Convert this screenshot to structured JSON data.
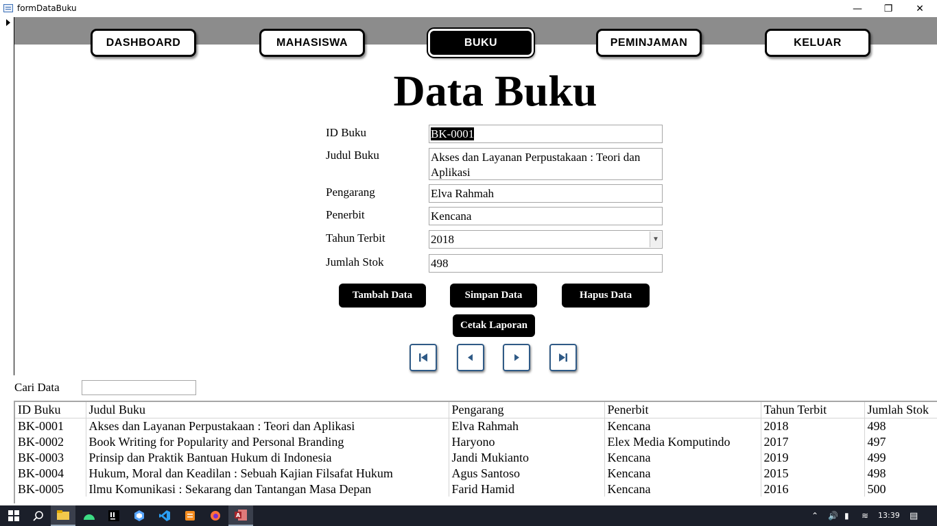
{
  "window": {
    "title": "formDataBuku",
    "minimize": "—",
    "restore": "❐",
    "close": "✕"
  },
  "nav": {
    "dashboard": "DASHBOARD",
    "mahasiswa": "MAHASISWA",
    "buku": "BUKU",
    "peminjaman": "PEMINJAMAN",
    "keluar": "KELUAR",
    "active": "BUKU"
  },
  "page": {
    "title": "Data Buku"
  },
  "form": {
    "id_buku": {
      "label": "ID Buku",
      "value": "BK-0001"
    },
    "judul_buku": {
      "label": "Judul Buku",
      "value": "Akses dan Layanan Perpustakaan : Teori dan Aplikasi"
    },
    "pengarang": {
      "label": "Pengarang",
      "value": "Elva Rahmah"
    },
    "penerbit": {
      "label": "Penerbit",
      "value": "Kencana"
    },
    "tahun_terbit": {
      "label": "Tahun Terbit",
      "value": "2018"
    },
    "jumlah_stok": {
      "label": "Jumlah Stok",
      "value": "498"
    }
  },
  "actions": {
    "tambah": "Tambah Data",
    "simpan": "Simpan Data",
    "hapus": "Hapus Data",
    "cetak": "Cetak Laporan"
  },
  "search": {
    "label": "Cari Data",
    "value": ""
  },
  "table": {
    "columns": [
      "ID Buku",
      "Judul Buku",
      "Pengarang",
      "Penerbit",
      "Tahun Terbit",
      "Jumlah Stok"
    ],
    "rows": [
      [
        "BK-0001",
        "Akses dan Layanan Perpustakaan : Teori dan Aplikasi",
        "Elva Rahmah",
        "Kencana",
        "2018",
        "498"
      ],
      [
        "BK-0002",
        "Book Writing for Popularity and Personal Branding",
        "Haryono",
        "Elex Media Komputindo",
        "2017",
        "497"
      ],
      [
        "BK-0003",
        "Prinsip dan Praktik Bantuan Hukum di Indonesia",
        "Jandi Mukianto",
        "Kencana",
        "2019",
        "499"
      ],
      [
        "BK-0004",
        "Hukum, Moral dan Keadilan : Sebuah Kajian Filsafat Hukum",
        "Agus Santoso",
        "Kencana",
        "2015",
        "498"
      ],
      [
        "BK-0005",
        "Ilmu Komunikasi : Sekarang dan Tantangan Masa Depan",
        "Farid Hamid",
        "Kencana",
        "2016",
        "500"
      ]
    ]
  },
  "taskbar": {
    "clock": "13:39",
    "icons": [
      "windows-start-icon",
      "search-icon",
      "file-explorer-icon",
      "android-studio-icon",
      "intellij-icon",
      "app-icon",
      "vscode-icon",
      "sublime-icon",
      "firefox-icon",
      "access-icon"
    ]
  },
  "colors": {
    "header_band": "#8c8c8c",
    "nav_active_bg": "#000000",
    "record_nav_border": "#2f5a86",
    "taskbar_bg": "#1b1f2a"
  }
}
